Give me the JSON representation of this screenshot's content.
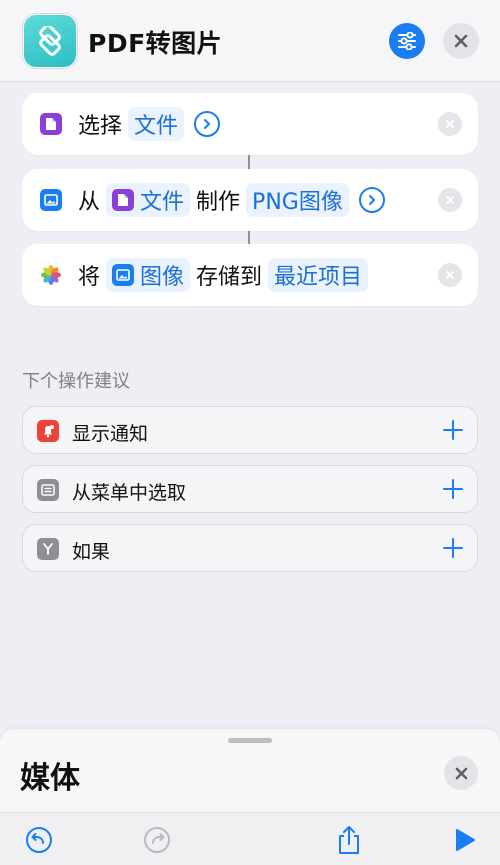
{
  "header": {
    "title": "PDF转图片"
  },
  "actions": [
    {
      "parts": [
        "选择",
        "文件"
      ]
    },
    {
      "parts": [
        "从",
        "文件",
        "制作",
        "PNG图像"
      ]
    },
    {
      "parts": [
        "将",
        "图像",
        "存储到",
        "最近项目"
      ]
    }
  ],
  "suggestions": {
    "heading": "下个操作建议",
    "items": [
      {
        "label": "显示通知",
        "icon": "notification-icon",
        "color": "#ee4237"
      },
      {
        "label": "从菜单中选取",
        "icon": "menu-icon",
        "color": "#8e8e93"
      },
      {
        "label": "如果",
        "icon": "branch-icon",
        "color": "#8e8e93"
      }
    ]
  },
  "sheet": {
    "title": "媒体"
  },
  "colors": {
    "accent": "#1a7ef2",
    "token_bg": "#e9f2fd",
    "file_purple": "#8a3fd9",
    "image_blue": "#1a7ef2"
  }
}
